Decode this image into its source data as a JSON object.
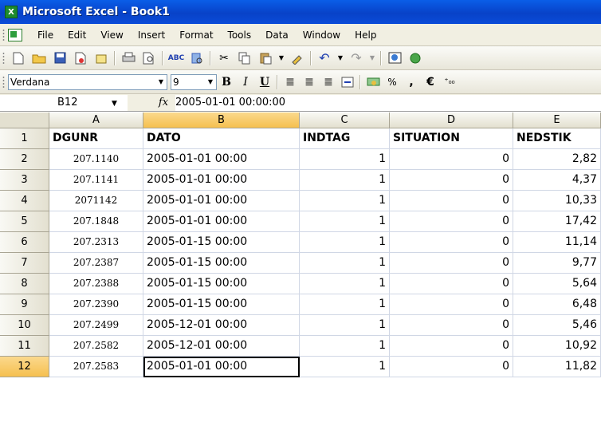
{
  "window": {
    "title": "Microsoft Excel - Book1",
    "icon": "excel-icon"
  },
  "menu": [
    "File",
    "Edit",
    "View",
    "Insert",
    "Format",
    "Tools",
    "Data",
    "Window",
    "Help"
  ],
  "format_toolbar": {
    "font": "Verdana",
    "size": "9",
    "percent": "%",
    "comma": ",",
    "euro": "€",
    "increase_decimal": "⁺₀₀"
  },
  "formula_bar": {
    "name_box": "B12",
    "fx": "fx",
    "formula": "2005-01-01  00:00:00"
  },
  "columns": [
    "A",
    "B",
    "C",
    "D",
    "E"
  ],
  "selected_column": "B",
  "selected_row": "12",
  "rows": [
    {
      "num": "1",
      "cells": [
        "DGUNR",
        "DATO",
        "INDTAG",
        "SITUATION",
        "NEDSTIK"
      ]
    },
    {
      "num": "2",
      "cells": [
        "207.1140",
        "2005-01-01 00:00",
        "1",
        "0",
        "2,82"
      ]
    },
    {
      "num": "3",
      "cells": [
        "207.1141",
        "2005-01-01 00:00",
        "1",
        "0",
        "4,37"
      ]
    },
    {
      "num": "4",
      "cells": [
        "2071142",
        "2005-01-01 00:00",
        "1",
        "0",
        "10,33"
      ]
    },
    {
      "num": "5",
      "cells": [
        "207.1848",
        "2005-01-01 00:00",
        "1",
        "0",
        "17,42"
      ]
    },
    {
      "num": "6",
      "cells": [
        "207.2313",
        "2005-01-15 00:00",
        "1",
        "0",
        "11,14"
      ]
    },
    {
      "num": "7",
      "cells": [
        "207.2387",
        "2005-01-15 00:00",
        "1",
        "0",
        "9,77"
      ]
    },
    {
      "num": "8",
      "cells": [
        "207.2388",
        "2005-01-15 00:00",
        "1",
        "0",
        "5,64"
      ]
    },
    {
      "num": "9",
      "cells": [
        "207.2390",
        "2005-01-15 00:00",
        "1",
        "0",
        "6,48"
      ]
    },
    {
      "num": "10",
      "cells": [
        "207.2499",
        "2005-12-01 00:00",
        "1",
        "0",
        "5,46"
      ]
    },
    {
      "num": "11",
      "cells": [
        "207.2582",
        "2005-12-01 00:00",
        "1",
        "0",
        "10,92"
      ]
    },
    {
      "num": "12",
      "cells": [
        "207.2583",
        "2005-01-01 00:00",
        "1",
        "0",
        "11,82"
      ]
    }
  ]
}
